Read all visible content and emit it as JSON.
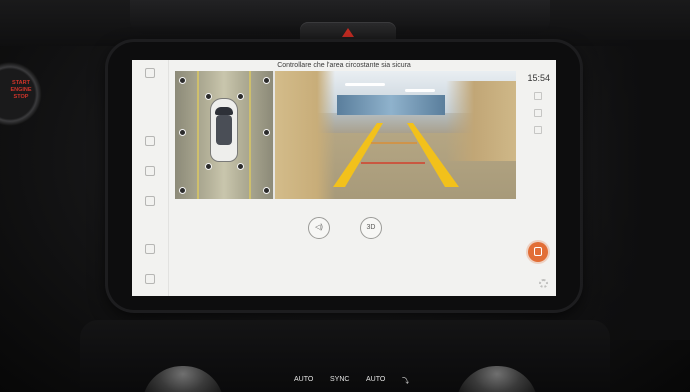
{
  "screen": {
    "title": "Controllare che l'area circostante sia sicura",
    "clock": "15:54"
  },
  "physical": {
    "start_stop": "START ENGINE STOP",
    "climate": {
      "auto_left": "AUTO",
      "sync": "SYNC",
      "auto_right": "AUTO"
    }
  },
  "icons": {
    "speaker": "speaker-icon",
    "view_3d": "3d-view-icon",
    "fab": "camera-switch-icon",
    "settings": "gear-icon"
  },
  "colors": {
    "guide_lines": "#f2c11b",
    "guide_red": "#d2412b",
    "accent": "#e26e36"
  }
}
